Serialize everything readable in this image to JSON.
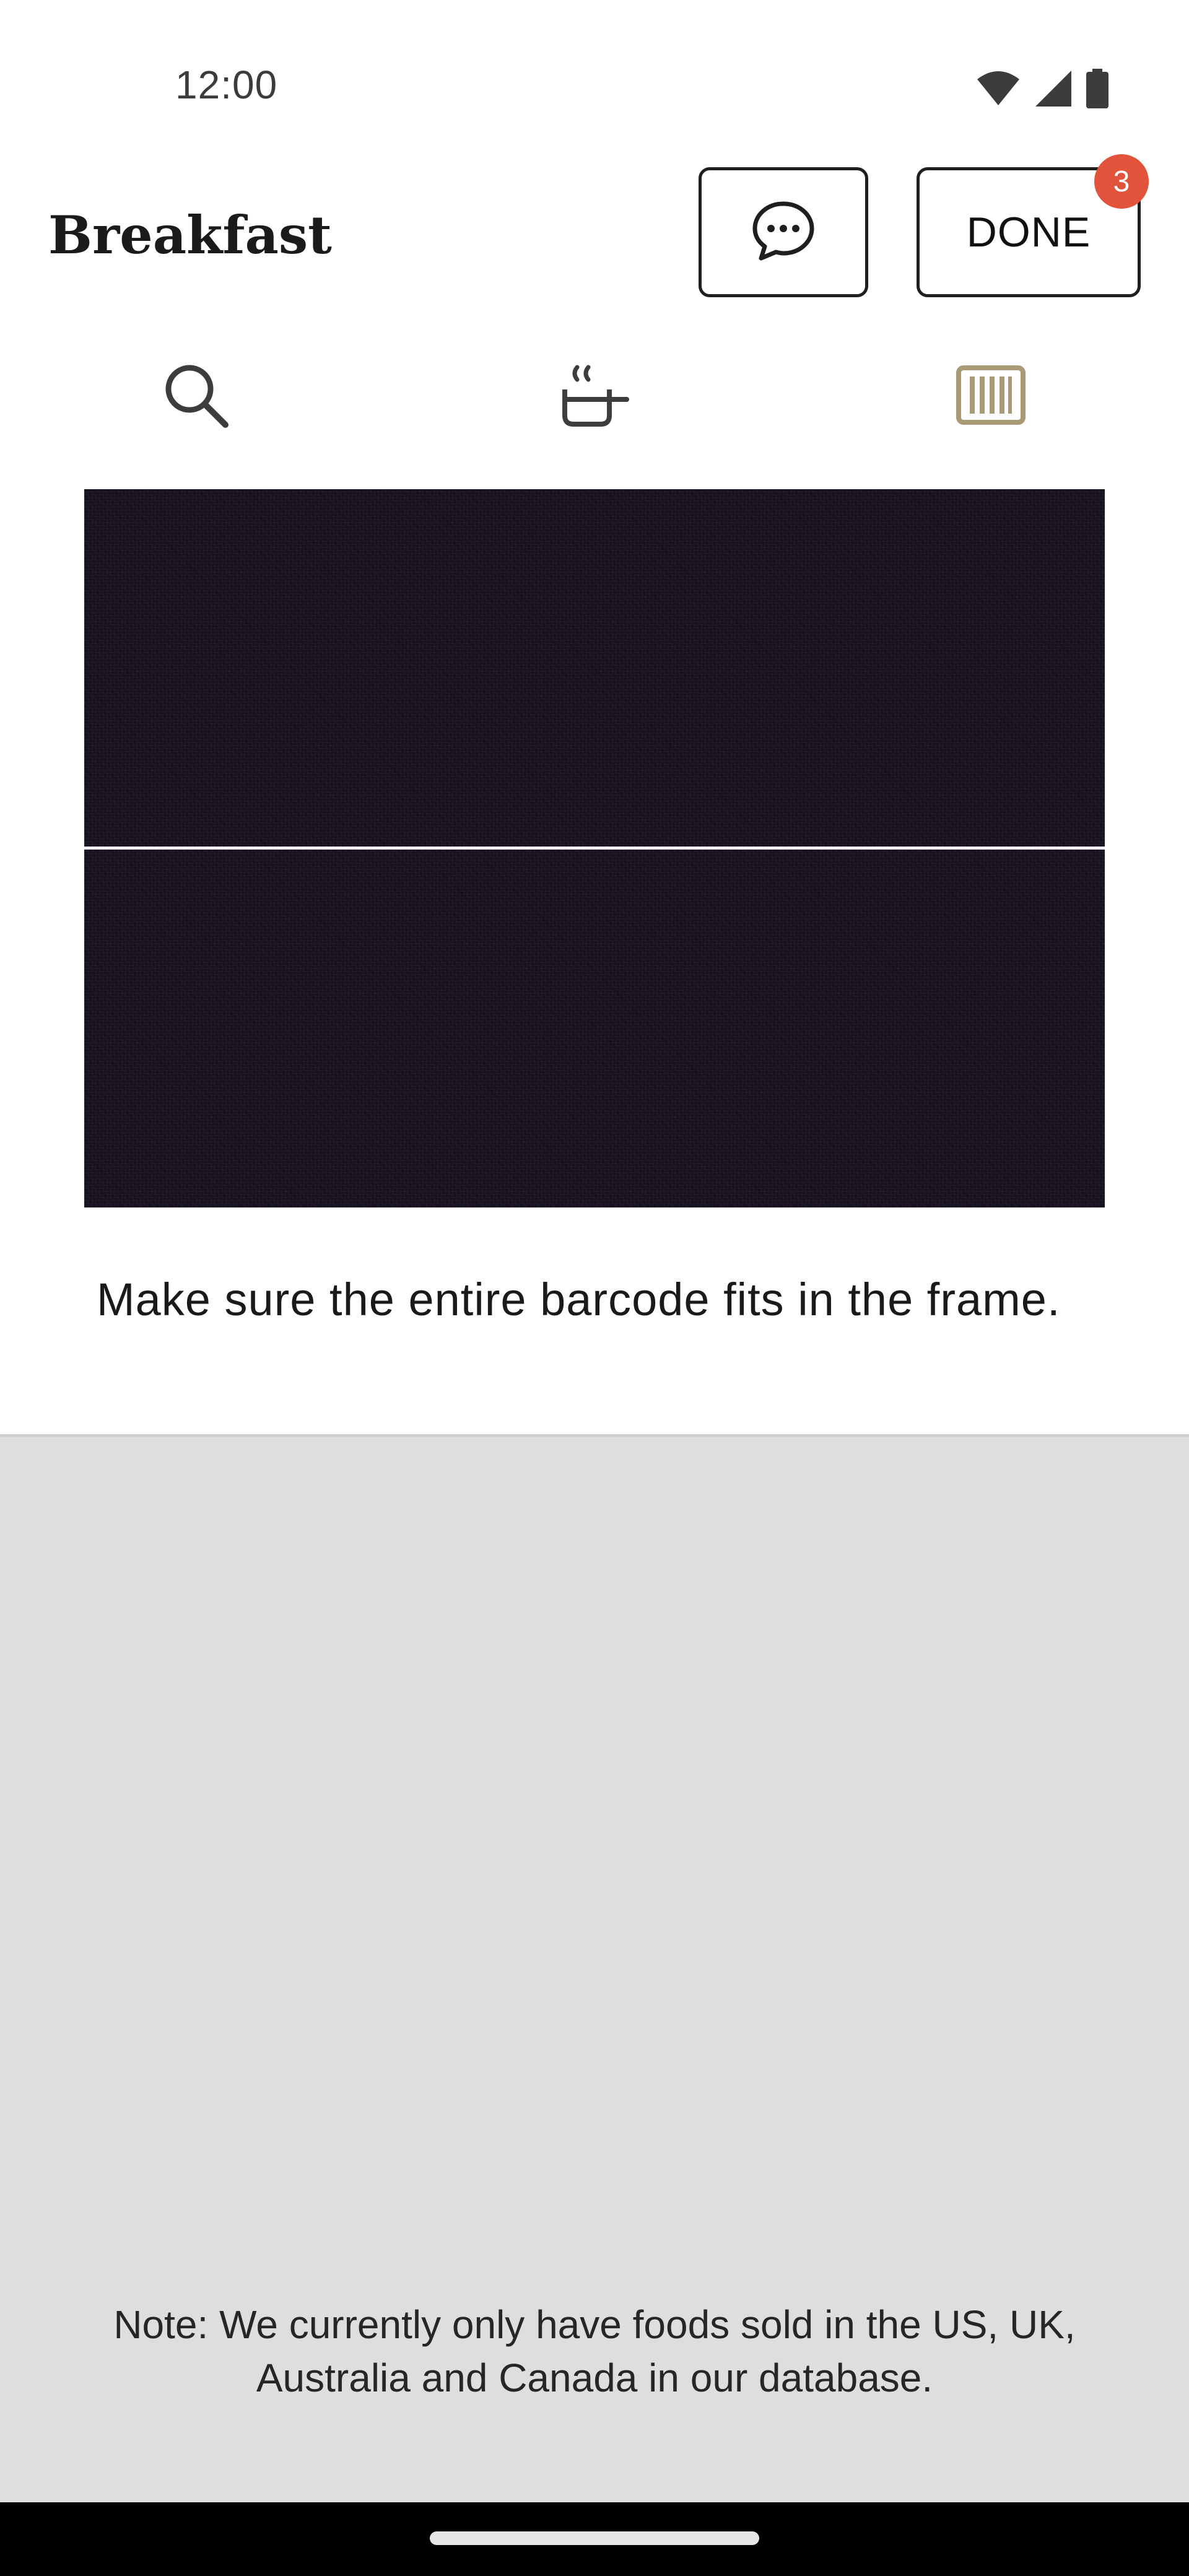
{
  "status_bar": {
    "time": "12:00"
  },
  "header": {
    "title": "Breakfast",
    "chat_button_icon": "chat-bubble-icon",
    "done_label": "DONE",
    "done_badge_count": "3",
    "badge_color": "#e2533b"
  },
  "tabs": [
    {
      "icon": "search-icon",
      "active": false
    },
    {
      "icon": "recipes-pot-icon",
      "active": false
    },
    {
      "icon": "barcode-icon",
      "active": true
    }
  ],
  "colors": {
    "active_tab": "#a89a74",
    "inactive_tab": "#3d3d3d",
    "camera_bg": "#15101c",
    "gray_area": "#dedede"
  },
  "scanner": {
    "hint": "Make sure the entire barcode fits in the frame."
  },
  "footer": {
    "note": "Note: We currently only have foods sold in the US, UK, Australia and Canada in our database."
  }
}
